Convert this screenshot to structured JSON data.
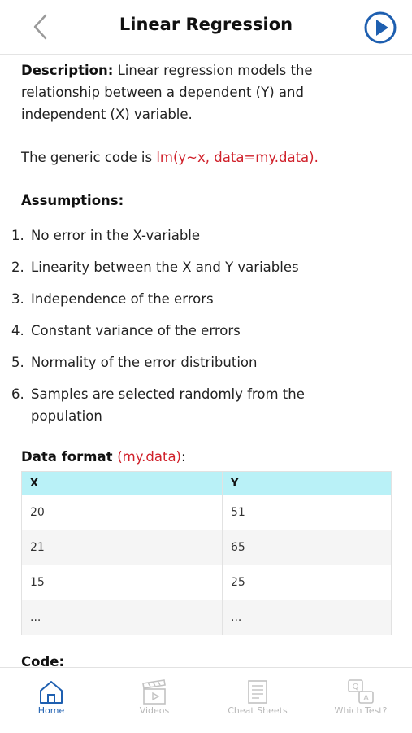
{
  "header": {
    "title": "Linear Regression"
  },
  "description": {
    "label": "Description:",
    "text": " Linear regression models the relationship between a dependent (Y) and independent (X) variable."
  },
  "generic_code": {
    "prefix": "The generic code is ",
    "code": "lm(y~x, data=my.data)",
    "suffix": "."
  },
  "assumptions": {
    "heading": "Assumptions:",
    "items": [
      {
        "num": "1.",
        "text": "No error in the X-variable"
      },
      {
        "num": "2.",
        "text": "Linearity between the X and Y variables"
      },
      {
        "num": "3.",
        "text": "Independence of the errors"
      },
      {
        "num": "4.",
        "text": "Constant variance of the errors"
      },
      {
        "num": "5.",
        "text": "Normality of the error distribution"
      },
      {
        "num": "6.",
        "text": "Samples are selected randomly from the population"
      }
    ]
  },
  "data_format": {
    "label": "Data format",
    "code": "(my.data)",
    "suffix": ":",
    "columns": [
      "X",
      "Y"
    ],
    "rows": [
      [
        "20",
        "51"
      ],
      [
        "21",
        "65"
      ],
      [
        "15",
        "25"
      ],
      [
        "...",
        "..."
      ]
    ]
  },
  "code_section": {
    "heading": "Code:"
  },
  "tabs": [
    {
      "label": "Home",
      "icon": "home-icon",
      "active": true
    },
    {
      "label": "Videos",
      "icon": "clapperboard-icon",
      "active": false
    },
    {
      "label": "Cheat Sheets",
      "icon": "cheat-sheets-icon",
      "active": false
    },
    {
      "label": "Which Test?",
      "icon": "which-test-icon",
      "active": false
    }
  ],
  "colors": {
    "accent": "#1e5fb0",
    "code_red": "#d0202a",
    "table_header": "#b9f1f7",
    "inactive_tab": "#b8b8b8"
  }
}
